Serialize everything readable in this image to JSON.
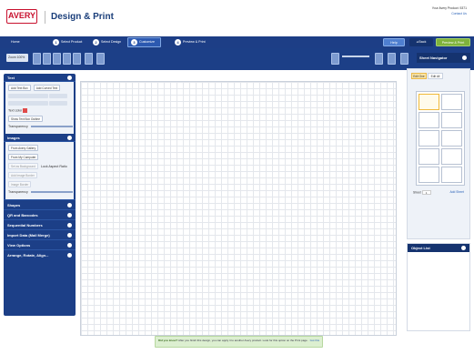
{
  "header": {
    "logo_text": "AVERY",
    "app_title": "Design & Print",
    "user_text": "Your Avery Product: 5371",
    "user_link": "Contact Us"
  },
  "steps": [
    {
      "label": "Home"
    },
    {
      "num": "1",
      "label": "Select Product"
    },
    {
      "num": "2",
      "label": "Select Design"
    },
    {
      "num": "3",
      "label": "Customize"
    },
    {
      "num": "4",
      "label": "Preview & Print"
    }
  ],
  "nav_buttons": {
    "help": "Help",
    "back": "Back",
    "next": "Preview & Print"
  },
  "toolbar": {
    "zoom_value": "Zoom 100%",
    "sheet_navigator": "Sheet Navigator"
  },
  "left_panel": {
    "text_title": "Text",
    "add_textbox": "Add Text Box",
    "add_arc_text": "Add Curved Text",
    "text_color_label": "Text color",
    "show_outline": "Show Text Box Outline",
    "transparency_label": "Transparency",
    "images_title": "Images",
    "from_gallery": "From Avery Gallery",
    "from_computer": "From My Computer",
    "from_background": "Set as Background",
    "lock_ratio": "Lock Aspect Ratio",
    "add_border": "Add Image Border",
    "image_border": "Image Border",
    "transparency_label2": "Transparency",
    "sections": [
      "Shapes",
      "QR and Barcodes",
      "Sequential Numbers",
      "Import Data (Mail Merge)",
      "View Options",
      "Arrange, Rotate, Align..."
    ]
  },
  "right_panel": {
    "tab_edit_one": "Edit One",
    "tab_edit_all": "Edit All",
    "sheet_label": "Sheet",
    "sheet_value": "1",
    "add_sheet": "Add Sheet",
    "object_list": "Object List"
  },
  "tip": {
    "title": "Did you know?",
    "text": "After you finish this design, you can apply it to another Avery product. Look for this option on the Print page.",
    "link": "Got this"
  },
  "colors": {
    "brand_red": "#c8102e",
    "navy": "#1c3f87",
    "accent_green": "#7fb33c"
  }
}
